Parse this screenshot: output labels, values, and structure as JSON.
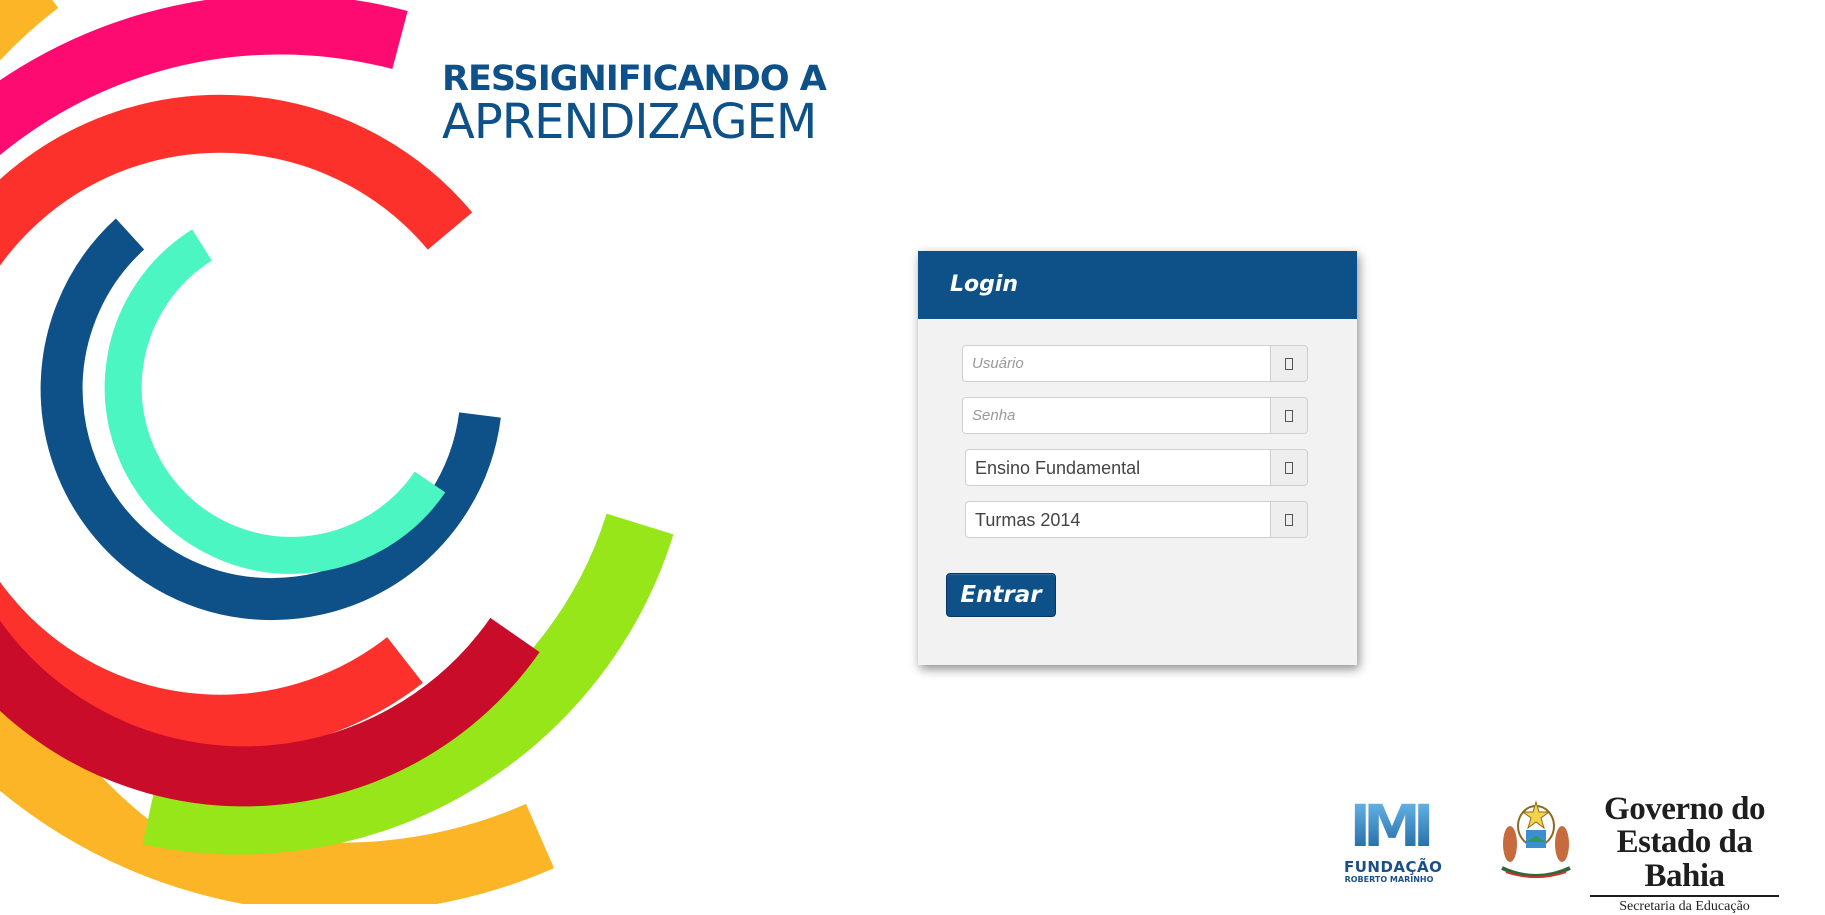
{
  "branding": {
    "title_line1": "RESSIGNIFICANDO A",
    "title_line2": "APRENDIZAGEM",
    "brand_color": "#0e5088",
    "arc_colors": [
      "#fbb526",
      "#fd0b71",
      "#fd312b",
      "#0e5088",
      "#4bf6c3",
      "#c80c2a",
      "#96e619"
    ]
  },
  "login": {
    "header": "Login",
    "username_placeholder": "Usuário",
    "password_placeholder": "Senha",
    "level_selected": "Ensino Fundamental",
    "class_selected": "Turmas 2014",
    "submit_label": "Entrar",
    "icons": [
      "user-icon",
      "lock-icon",
      "list-icon",
      "list-icon"
    ]
  },
  "footer": {
    "foundation_line1": "FUNDAÇÃO",
    "foundation_line2": "ROBERTO MARINHO",
    "gov_line1": "Governo do",
    "gov_line2": "Estado da Bahia",
    "gov_line3": "Secretaria da Educação"
  }
}
